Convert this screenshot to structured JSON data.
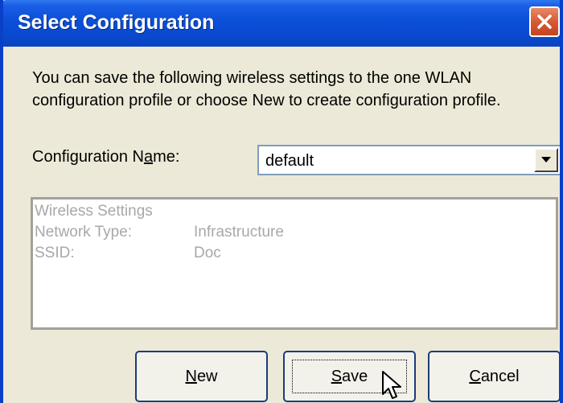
{
  "window": {
    "title": "Select Configuration",
    "accent_color": "#0a49cf",
    "close_color": "#d65a34"
  },
  "description": "You can save the following wireless settings to the one WLAN configuration profile or choose New to create configuration profile.",
  "configuration": {
    "label_prefix": "Configuration N",
    "label_mnemonic": "a",
    "label_suffix": "me:",
    "selected_value": "default"
  },
  "settings": {
    "heading": "Wireless Settings",
    "rows": [
      {
        "label": "Network Type:",
        "value": "Infrastructure"
      },
      {
        "label": "SSID:",
        "value": "Doc"
      }
    ]
  },
  "buttons": {
    "new": {
      "mnemonic": "N",
      "rest": "ew"
    },
    "save": {
      "mnemonic": "S",
      "rest": "ave"
    },
    "cancel": {
      "mnemonic": "C",
      "rest": "ancel"
    }
  },
  "icons": [
    "close-icon",
    "dropdown-arrow-icon",
    "mouse-cursor-icon"
  ]
}
